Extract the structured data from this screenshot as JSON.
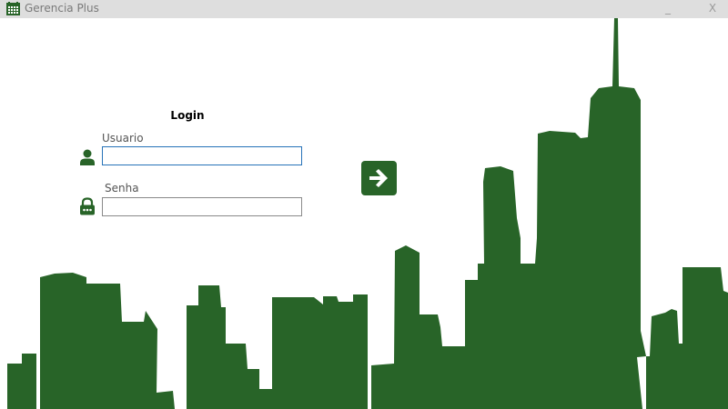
{
  "window": {
    "title": "Gerencia Plus",
    "minimize_label": "_",
    "close_label": "X",
    "app_icon": "calendar-grid-icon"
  },
  "colors": {
    "brand_green": "#286428",
    "focus_border": "#2672b8",
    "titlebar_bg": "#dedede"
  },
  "login": {
    "title": "Login",
    "username": {
      "label": "Usuario",
      "value": "",
      "icon": "user-icon"
    },
    "password": {
      "label": "Senha",
      "value": "",
      "icon": "lock-icon"
    },
    "submit_icon": "arrow-right-icon"
  },
  "background": {
    "icon": "city-skyline"
  }
}
